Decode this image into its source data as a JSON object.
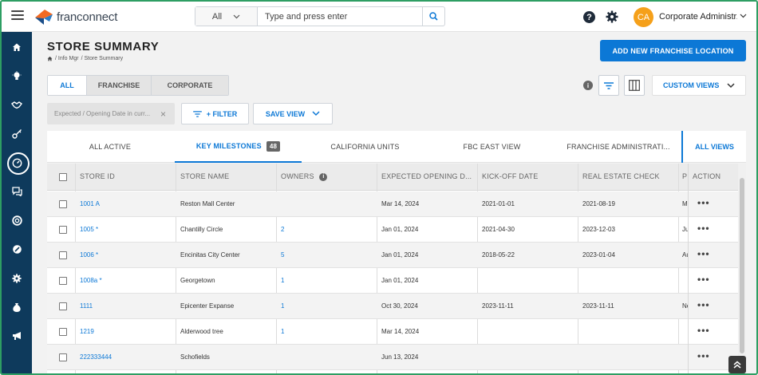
{
  "app": {
    "brand": "franconnect",
    "menu_icon": "hamburger-icon"
  },
  "search": {
    "scope": "All",
    "placeholder": "Type and press enter"
  },
  "user": {
    "initials": "CA",
    "name": "Corporate Administr..."
  },
  "page": {
    "title": "STORE SUMMARY",
    "breadcrumb": {
      "first": "/ Info Mgr",
      "second": "/ Store Summary"
    },
    "add_button": "ADD NEW FRANCHISE LOCATION"
  },
  "segments": [
    "ALL",
    "FRANCHISE",
    "CORPORATE"
  ],
  "toolbar": {
    "info": "i",
    "custom_views": "CUSTOM VIEWS"
  },
  "filters": {
    "chip": "Expected / Opening Date in curr...",
    "chip_close": "×",
    "filter_button": "+ FILTER",
    "save_view": "SAVE VIEW"
  },
  "views": {
    "tabs": [
      "ALL ACTIVE",
      "KEY MILESTONES",
      "CALIFORNIA UNITS",
      "FBC EAST VIEW",
      "FRANCHISE ADMINISTRATI..."
    ],
    "active_count": "48",
    "all_views": "ALL VIEWS"
  },
  "table": {
    "headers": [
      "STORE ID",
      "STORE NAME",
      "OWNERS",
      "EXPECTED OPENING D...",
      "KICK-OFF DATE",
      "REAL ESTATE CHECK",
      "P",
      "ACTION"
    ],
    "owners_info": "i",
    "rows": [
      {
        "id": "1001 A",
        "name": "Reston Mall Center",
        "owners": "",
        "opening": "Mar 14, 2024",
        "kickoff": "2021-01-01",
        "realestate": "2021-08-19",
        "p": "Ma"
      },
      {
        "id": "1005 *",
        "name": "Chantilly Circle",
        "owners": "2",
        "opening": "Jan 01, 2024",
        "kickoff": "2021-04-30",
        "realestate": "2023-12-03",
        "p": "Ju"
      },
      {
        "id": "1006 *",
        "name": "Encinitas City Center",
        "owners": "5",
        "opening": "Jan 01, 2024",
        "kickoff": "2018-05-22",
        "realestate": "2023-01-04",
        "p": "Au"
      },
      {
        "id": "1008a *",
        "name": "Georgetown",
        "owners": "1",
        "opening": "Jan 01, 2024",
        "kickoff": "",
        "realestate": "",
        "p": ""
      },
      {
        "id": "1111",
        "name": "Epicenter Expanse",
        "owners": "1",
        "opening": "Oct 30, 2024",
        "kickoff": "2023-11-11",
        "realestate": "2023-11-11",
        "p": "No"
      },
      {
        "id": "1219",
        "name": "Alderwood tree",
        "owners": "1",
        "opening": "Mar 14, 2024",
        "kickoff": "",
        "realestate": "",
        "p": ""
      },
      {
        "id": "222333444",
        "name": "Schofields",
        "owners": "",
        "opening": "Jun 13, 2024",
        "kickoff": "",
        "realestate": "",
        "p": ""
      }
    ],
    "action_label": "•••"
  },
  "colors": {
    "accent": "#0c78d6",
    "sidebar": "#0e3a5c",
    "avatar": "#f5a01a",
    "frame": "#2e9e63"
  }
}
